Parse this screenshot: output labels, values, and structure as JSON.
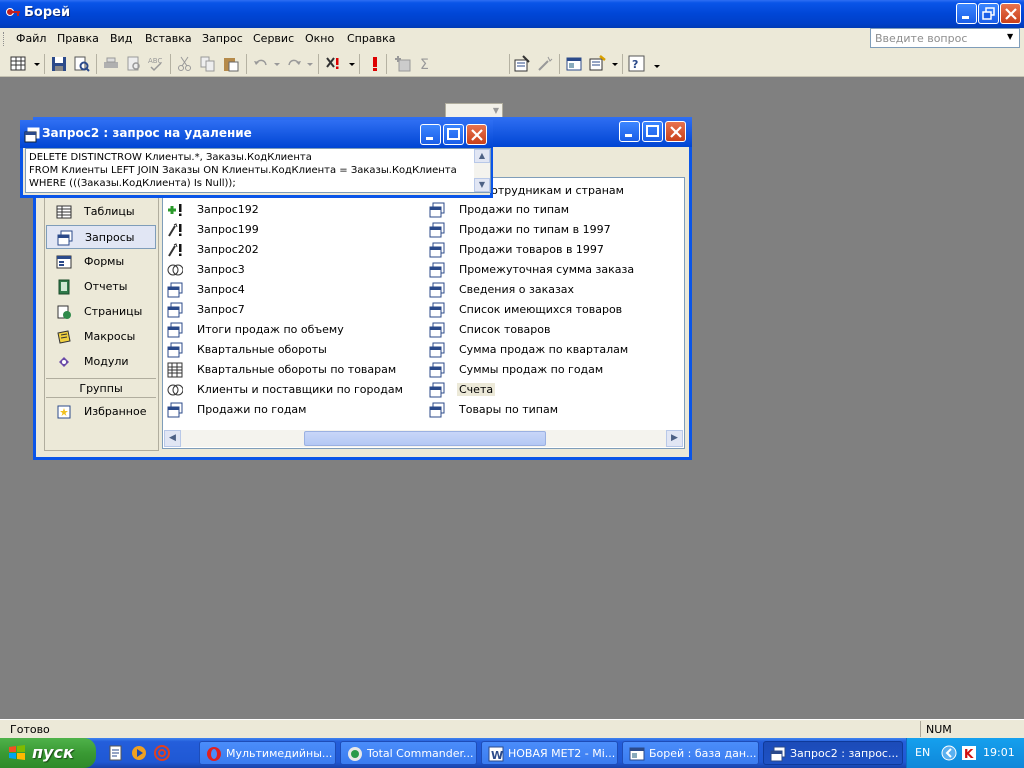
{
  "app": {
    "title": "Борей"
  },
  "menu": {
    "items": [
      "Файл",
      "Правка",
      "Вид",
      "Вставка",
      "Запрос",
      "Сервис",
      "Окно",
      "Справка"
    ],
    "ask_placeholder": "Введите вопрос"
  },
  "toolbar": {
    "icons": [
      "datasheet-view-icon",
      "save-icon",
      "search-file-icon",
      "print-icon",
      "print-preview-icon",
      "spelling-icon",
      "cut-icon",
      "copy-icon",
      "paste-icon",
      "undo-icon",
      "redo-icon",
      "query-type-icon",
      "run-icon",
      "show-table-icon",
      "totals-icon",
      "properties-icon",
      "build-icon",
      "database-window-icon",
      "new-object-icon",
      "help-icon"
    ]
  },
  "query_window": {
    "title": "Запрос2 : запрос на удаление",
    "sql_lines": [
      "DELETE DISTINCTROW Клиенты.*, Заказы.КодКлиента",
      "FROM Клиенты LEFT JOIN Заказы ON Клиенты.КодКлиента = Заказы.КодКлиента",
      "WHERE (((Заказы.КодКлиента) Is Null));"
    ]
  },
  "db_window": {
    "nav": [
      {
        "label": "Таблицы",
        "icon": "table-icon"
      },
      {
        "label": "Запросы",
        "icon": "query-icon",
        "selected": true
      },
      {
        "label": "Формы",
        "icon": "form-icon"
      },
      {
        "label": "Отчеты",
        "icon": "report-icon"
      },
      {
        "label": "Страницы",
        "icon": "page-icon"
      },
      {
        "label": "Макросы",
        "icon": "macro-icon"
      },
      {
        "label": "Модули",
        "icon": "module-icon"
      }
    ],
    "groups_label": "Группы",
    "favorites_label": "Избранное",
    "objects_col1": [
      {
        "label": "Запрос192",
        "icon": "append-query-icon"
      },
      {
        "label": "Запрос199",
        "icon": "update-query-icon"
      },
      {
        "label": "Запрос202",
        "icon": "update-query-icon"
      },
      {
        "label": "Запрос3",
        "icon": "union-query-icon"
      },
      {
        "label": "Запрос4",
        "icon": "select-query-icon"
      },
      {
        "label": "Запрос7",
        "icon": "select-query-icon"
      },
      {
        "label": "Итоги продаж по объему",
        "icon": "select-query-icon"
      },
      {
        "label": "Квартальные обороты",
        "icon": "select-query-icon"
      },
      {
        "label": "Квартальные обороты по товарам",
        "icon": "crosstab-query-icon"
      },
      {
        "label": "Клиенты и поставщики по городам",
        "icon": "union-query-icon"
      },
      {
        "label": "Продажи по годам",
        "icon": "select-query-icon"
      }
    ],
    "objects_col2_partial": "и по сотрудникам и странам",
    "objects_col2": [
      {
        "label": "Продажи по типам",
        "icon": "select-query-icon"
      },
      {
        "label": "Продажи по типам в 1997",
        "icon": "select-query-icon"
      },
      {
        "label": "Продажи товаров в 1997",
        "icon": "select-query-icon"
      },
      {
        "label": "Промежуточная сумма заказа",
        "icon": "select-query-icon"
      },
      {
        "label": "Сведения о заказах",
        "icon": "select-query-icon"
      },
      {
        "label": "Список имеющихся товаров",
        "icon": "select-query-icon"
      },
      {
        "label": "Список товаров",
        "icon": "select-query-icon"
      },
      {
        "label": "Сумма продаж по кварталам",
        "icon": "select-query-icon"
      },
      {
        "label": "Суммы продаж по годам",
        "icon": "select-query-icon"
      },
      {
        "label": "Счета",
        "icon": "select-query-icon",
        "selected": true
      },
      {
        "label": "Товары по типам",
        "icon": "select-query-icon"
      }
    ]
  },
  "status": {
    "text": "Готово",
    "num": "NUM"
  },
  "taskbar": {
    "start_label": "пуск",
    "tasks": [
      {
        "label": "Мультимедийны...",
        "icon": "opera-icon"
      },
      {
        "label": "Total Commander...",
        "icon": "total-commander-icon"
      },
      {
        "label": "НОВАЯ МЕТ2 - Mi...",
        "icon": "word-icon"
      },
      {
        "label": "Борей : база дан...",
        "icon": "database-icon"
      },
      {
        "label": "Запрос2 : запрос...",
        "icon": "query-icon",
        "active": true
      }
    ],
    "lang": "EN",
    "clock": "19:01"
  },
  "colors": {
    "xp_blue": "#0a55e8",
    "face": "#ece9d8",
    "desktop": "#808080",
    "close_red": "#c9401a",
    "start_green": "#3a9a34"
  }
}
